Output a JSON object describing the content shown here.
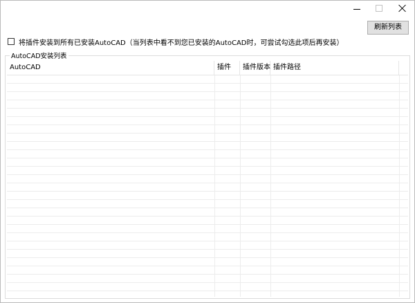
{
  "window": {
    "title": "",
    "controls": [
      "minimize-icon",
      "maximize-icon",
      "close-icon"
    ]
  },
  "toolbar": {
    "refresh_label": "刷新列表"
  },
  "install_all": {
    "checked": false,
    "label": "将插件安装到所有已安装AutoCAD（当列表中看不到您已安装的AutoCAD时，可尝试勾选此项后再安装）"
  },
  "group": {
    "title": "AutoCAD安装列表"
  },
  "list": {
    "columns": [
      "AutoCAD",
      "插件",
      "插件版本",
      "插件路径"
    ],
    "rows": []
  }
}
